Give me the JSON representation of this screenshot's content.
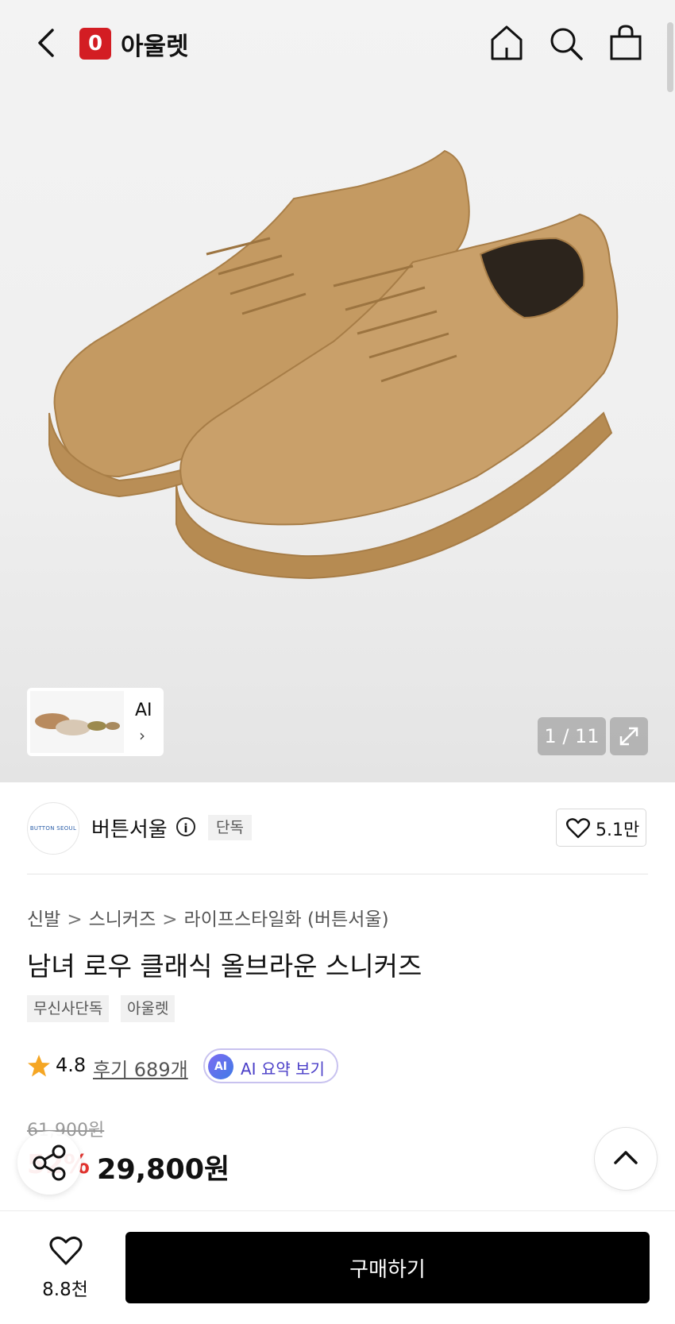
{
  "header": {
    "store_badge": "0",
    "store_name": "아울렛"
  },
  "gallery": {
    "ai_label": "AI",
    "ai_chevron": "›",
    "counter": "1 / 11"
  },
  "brand": {
    "logo_text": "BUTTON SEOUL",
    "name": "버튼서울",
    "info_icon": "i",
    "exclusive_label": "단독",
    "like_count": "5.1만"
  },
  "breadcrumb": {
    "items": [
      "신발",
      "스니커즈",
      "라이프스타일화 (버튼서울)"
    ],
    "separator": ">"
  },
  "product": {
    "title": "남녀 로우 클래식 올브라운 스니커즈",
    "tags": [
      "무신사단독",
      "아울렛"
    ],
    "rating": "4.8",
    "review_link": "후기 689개",
    "ai_badge": "AI",
    "ai_summary_label": "AI 요약 보기",
    "original_price": "61,900원",
    "discount": "52%",
    "sale_price": "29,800원"
  },
  "bottom_bar": {
    "like_count": "8.8천",
    "buy_label": "구매하기"
  },
  "colors": {
    "brand_red": "#d31d23",
    "discount_red": "#e3342f",
    "rating_star": "#f5a623",
    "ai_purple": "#4a3ec8"
  }
}
